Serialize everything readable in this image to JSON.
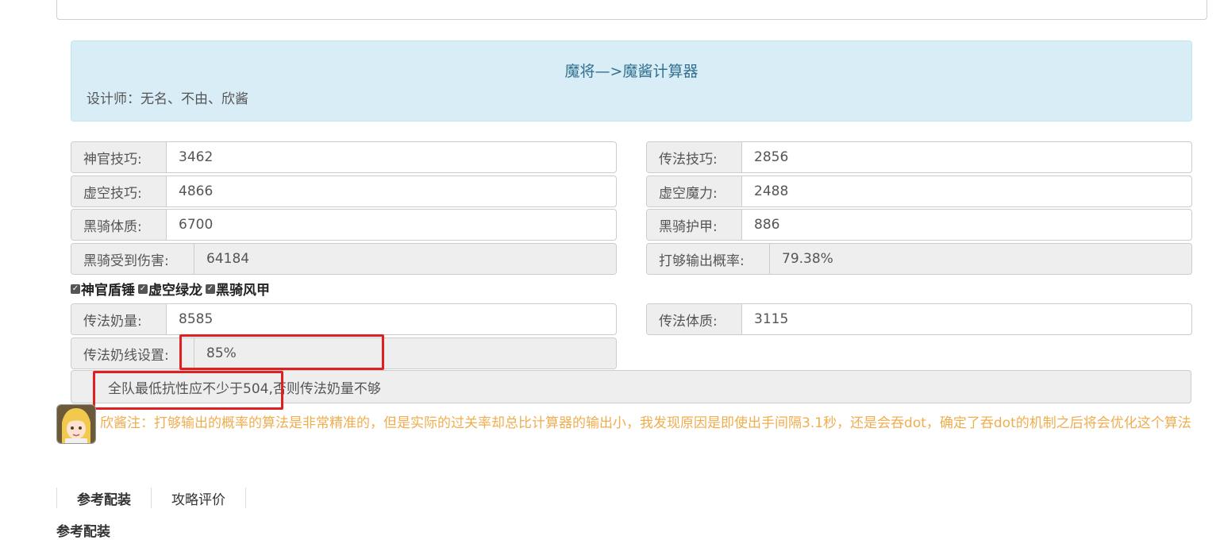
{
  "banner": {
    "title": "魔将—>魔酱计算器",
    "designer": "设计师：无名、不由、欣酱"
  },
  "fields": {
    "shenguan_skill": {
      "label": "神官技巧:",
      "value": "3462"
    },
    "chuanfa_skill": {
      "label": "传法技巧:",
      "value": "2856"
    },
    "xukong_skill": {
      "label": "虚空技巧:",
      "value": "4866"
    },
    "xukong_magic": {
      "label": "虚空魔力:",
      "value": "2488"
    },
    "heiqi_physique": {
      "label": "黑骑体质:",
      "value": "6700"
    },
    "heiqi_armor": {
      "label": "黑骑护甲:",
      "value": "886"
    },
    "heiqi_damage": {
      "label": "黑骑受到伤害:",
      "value": "64184"
    },
    "output_probability": {
      "label": "打够输出概率:",
      "value": "79.38%"
    },
    "chuanfa_heal": {
      "label": "传法奶量:",
      "value": "8585"
    },
    "chuanfa_physique": {
      "label": "传法体质:",
      "value": "3115"
    },
    "chuanfa_heal_threshold": {
      "label": "传法奶线设置:",
      "value": "85%"
    }
  },
  "checkboxes": [
    {
      "label": "神官盾锤",
      "checked": true
    },
    {
      "label": "虚空绿龙",
      "checked": true
    },
    {
      "label": "黑骑风甲",
      "checked": true
    }
  ],
  "notice": {
    "highlight": "全队最低抗性应不少于504,",
    "rest": " 否则传法奶量不够"
  },
  "note": "欣酱注：打够输出的概率的算法是非常精准的，但是实际的过关率却总比计算器的输出小，我发现原因是即使出手间隔3.1秒，还是会吞dot，确定了吞dot的机制之后将会优化这个算法",
  "tabs": [
    {
      "label": "参考配装",
      "active": true
    },
    {
      "label": "攻略评价",
      "active": false
    }
  ],
  "cut_heading": "参考配装",
  "colors": {
    "banner_bg": "#d9edf7",
    "banner_title": "#31708f",
    "note": "#f0ad4e",
    "highlight_border": "#e02020"
  }
}
